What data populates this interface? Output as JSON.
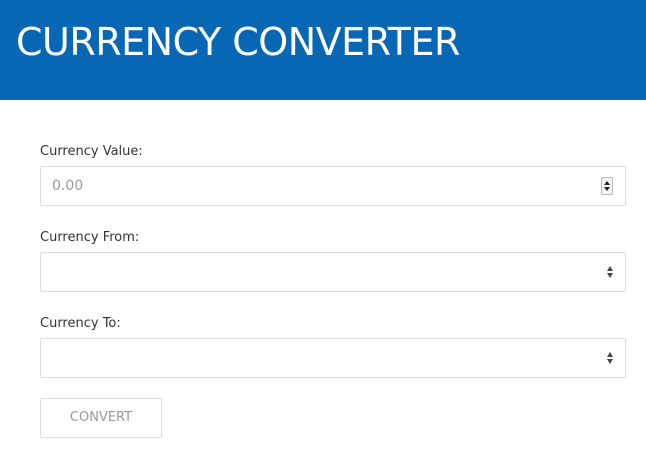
{
  "header": {
    "title": "CURRENCY CONVERTER",
    "background_color": "#0767b5"
  },
  "form": {
    "value_field": {
      "label": "Currency Value:",
      "placeholder": "0.00",
      "value": ""
    },
    "from_field": {
      "label": "Currency From:",
      "selected": ""
    },
    "to_field": {
      "label": "Currency To:",
      "selected": ""
    },
    "convert_button": {
      "label": "CONVERT",
      "enabled": false
    }
  },
  "icons": {
    "spinner": "number-spinner-icon",
    "select_arrows": "select-updown-arrows-icon"
  }
}
